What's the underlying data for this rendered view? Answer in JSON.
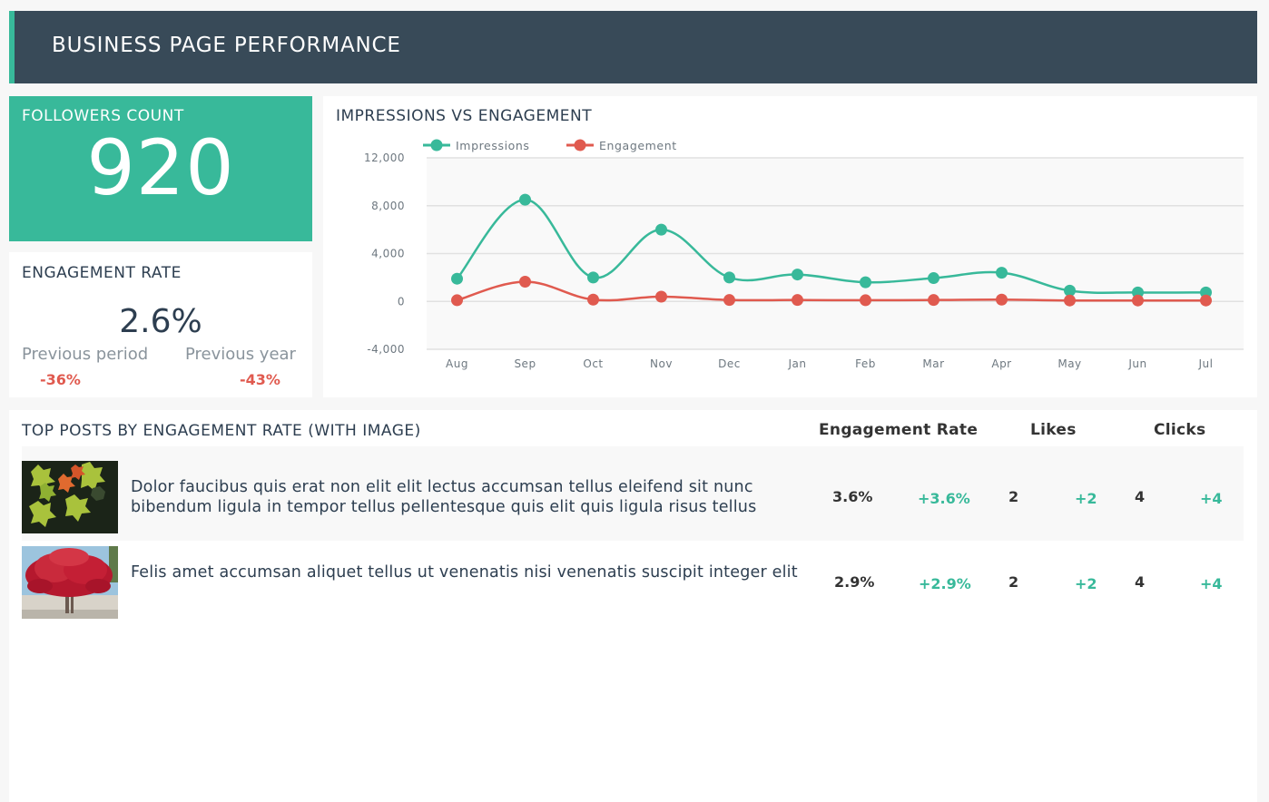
{
  "header": {
    "title": "BUSINESS PAGE PERFORMANCE"
  },
  "colors": {
    "accent": "#38b99a",
    "header_bg": "#384a58",
    "negative": "#e05a4f",
    "impressions": "#38b99a",
    "engagement": "#e05a4f"
  },
  "followers": {
    "label": "FOLLOWERS COUNT",
    "value": "920"
  },
  "engagement_rate": {
    "label": "ENGAGEMENT RATE",
    "value": "2.6%",
    "previous_period": {
      "label": "Previous period",
      "value": "-36%"
    },
    "previous_year": {
      "label": "Previous year",
      "value": "-43%"
    }
  },
  "chart_data": {
    "type": "line",
    "title": "IMPRESSIONS VS ENGAGEMENT",
    "categories": [
      "Aug",
      "Sep",
      "Oct",
      "Nov",
      "Dec",
      "Jan",
      "Feb",
      "Mar",
      "Apr",
      "May",
      "Jun",
      "Jul"
    ],
    "series": [
      {
        "name": "Impressions",
        "color": "#38b99a",
        "values": [
          1900,
          8500,
          2000,
          6000,
          2000,
          2250,
          1600,
          1950,
          2400,
          900,
          750,
          750
        ]
      },
      {
        "name": "Engagement",
        "color": "#e05a4f",
        "values": [
          100,
          1650,
          150,
          400,
          120,
          120,
          100,
          120,
          150,
          80,
          80,
          80
        ]
      }
    ],
    "yticks": [
      "12,000",
      "8,000",
      "4,000",
      "0",
      "-4,000"
    ],
    "ytick_values": [
      12000,
      8000,
      4000,
      0,
      -4000
    ],
    "ylim": [
      -4000,
      12000
    ],
    "xlabel": "",
    "ylabel": "",
    "grid": true,
    "legend": "top-left",
    "smooth": true
  },
  "posts": {
    "title": "TOP POSTS BY ENGAGEMENT RATE (WITH IMAGE)",
    "columns": [
      "Engagement Rate",
      "Likes",
      "Clicks"
    ],
    "rows": [
      {
        "image": "green-and-orange-leaves",
        "text": "Dolor faucibus quis erat non elit elit lectus accumsan tellus eleifend sit nunc bibendum ligula in tempor tellus pellentesque quis elit quis ligula risus tellus",
        "engagement_rate": "3.6%",
        "engagement_delta": "+3.6%",
        "likes": "2",
        "likes_delta": "+2",
        "clicks": "4",
        "clicks_delta": "+4"
      },
      {
        "image": "red-maple-tree",
        "text": "Felis amet accumsan aliquet tellus ut venenatis nisi venenatis suscipit integer elit",
        "engagement_rate": "2.9%",
        "engagement_delta": "+2.9%",
        "likes": "2",
        "likes_delta": "+2",
        "clicks": "4",
        "clicks_delta": "+4"
      }
    ]
  }
}
